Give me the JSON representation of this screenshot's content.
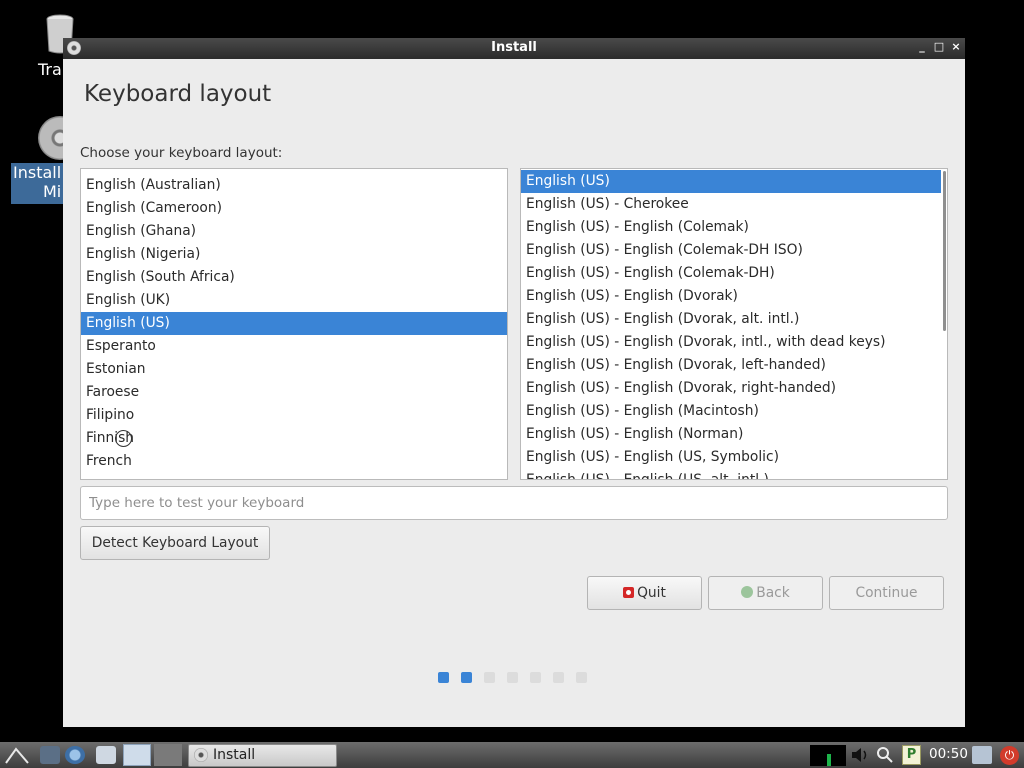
{
  "desktop": {
    "trash_label": "Tra",
    "install_label_line1": "Install",
    "install_label_line2": "Mi"
  },
  "window": {
    "title": "Install",
    "minimize": "_",
    "maximize": "□",
    "close": "×"
  },
  "page": {
    "title": "Keyboard layout",
    "prompt": "Choose your keyboard layout:"
  },
  "layouts": {
    "items": [
      "English (Australian)",
      "English (Cameroon)",
      "English (Ghana)",
      "English (Nigeria)",
      "English (South Africa)",
      "English (UK)",
      "English (US)",
      "Esperanto",
      "Estonian",
      "Faroese",
      "Filipino",
      "Finnish",
      "French"
    ],
    "selected": "English (US)"
  },
  "variants": {
    "items": [
      "English (US)",
      "English (US) - Cherokee",
      "English (US) - English (Colemak)",
      "English (US) - English (Colemak-DH ISO)",
      "English (US) - English (Colemak-DH)",
      "English (US) - English (Dvorak)",
      "English (US) - English (Dvorak, alt. intl.)",
      "English (US) - English (Dvorak, intl., with dead keys)",
      "English (US) - English (Dvorak, left-handed)",
      "English (US) - English (Dvorak, right-handed)",
      "English (US) - English (Macintosh)",
      "English (US) - English (Norman)",
      "English (US) - English (US, Symbolic)",
      "English (US) - English (US, alt. intl.)"
    ],
    "selected": "English (US)"
  },
  "test_input": {
    "placeholder": "Type here to test your keyboard",
    "value": ""
  },
  "buttons": {
    "detect": "Detect Keyboard Layout",
    "quit": "Quit",
    "back": "Back",
    "continue": "Continue"
  },
  "progress": {
    "total_steps": 7,
    "current_step": 2
  },
  "taskbar": {
    "task_label": "Install",
    "clock": "00:50",
    "tray_p": "P"
  },
  "colors": {
    "accent": "#3a84d6",
    "quit_icon": "#d42727"
  }
}
